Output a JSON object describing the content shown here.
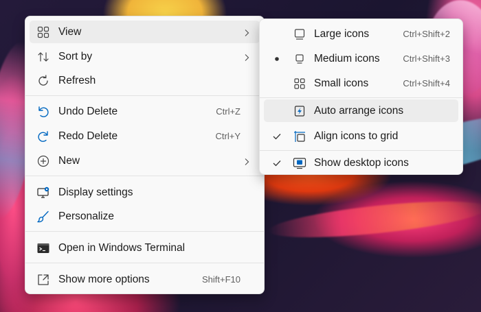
{
  "main_menu": {
    "items": [
      {
        "label": "View",
        "icon": "grid-icon"
      },
      {
        "label": "Sort by",
        "icon": "sort-icon"
      },
      {
        "label": "Refresh",
        "icon": "refresh-icon"
      },
      {
        "label": "Undo Delete",
        "shortcut": "Ctrl+Z",
        "icon": "undo-icon"
      },
      {
        "label": "Redo Delete",
        "shortcut": "Ctrl+Y",
        "icon": "redo-icon"
      },
      {
        "label": "New",
        "icon": "add-icon"
      },
      {
        "label": "Display settings",
        "icon": "display-icon"
      },
      {
        "label": "Personalize",
        "icon": "brush-icon"
      },
      {
        "label": "Open in Windows Terminal",
        "icon": "terminal-icon"
      },
      {
        "label": "Show more options",
        "shortcut": "Shift+F10",
        "icon": "expand-icon"
      }
    ]
  },
  "view_submenu": {
    "items": [
      {
        "label": "Large icons",
        "shortcut": "Ctrl+Shift+2",
        "icon": "large-icons-icon",
        "mark": ""
      },
      {
        "label": "Medium icons",
        "shortcut": "Ctrl+Shift+3",
        "icon": "medium-icons-icon",
        "mark": "bullet"
      },
      {
        "label": "Small icons",
        "shortcut": "Ctrl+Shift+4",
        "icon": "small-icons-icon",
        "mark": ""
      },
      {
        "label": "Auto arrange icons",
        "icon": "auto-arrange-icon",
        "mark": ""
      },
      {
        "label": "Align icons to grid",
        "icon": "align-grid-icon",
        "mark": "check"
      },
      {
        "label": "Show desktop icons",
        "icon": "desktop-icon",
        "mark": "check"
      }
    ]
  },
  "colors": {
    "menu_bg": "#f9f9f9",
    "hover_bg": "#ececec",
    "accent": "#0067c0",
    "text": "#1b1b1b",
    "shortcut_text": "#5f5f5f"
  }
}
